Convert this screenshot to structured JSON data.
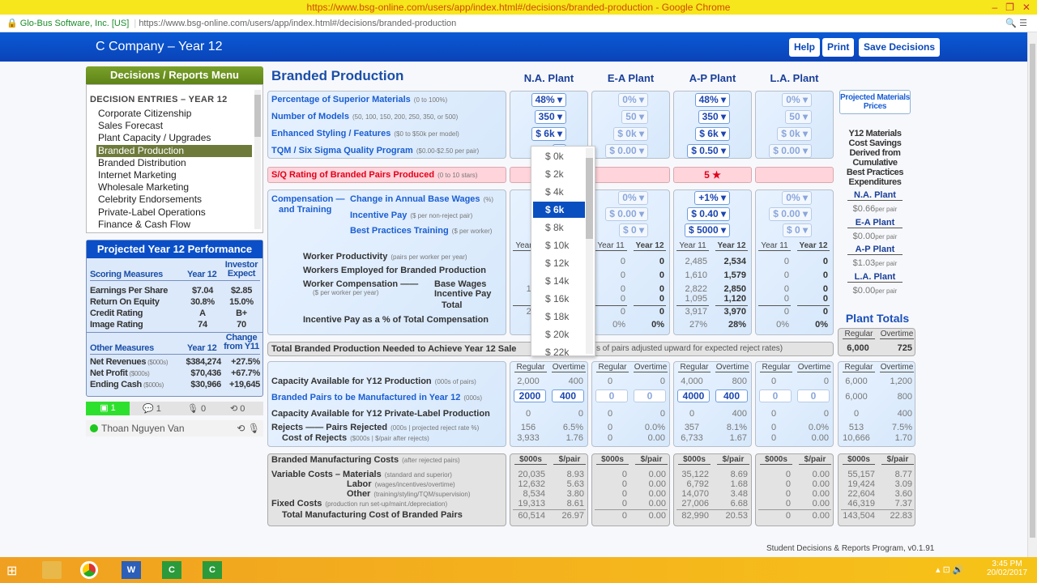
{
  "browser": {
    "title": "https://www.bsg-online.com/users/app/index.html#/decisions/branded-production - Google Chrome",
    "site_identity": "Glo-Bus Software, Inc. [US]",
    "url": "https://www.bsg-online.com/users/app/index.html#/decisions/branded-production"
  },
  "header": {
    "company": "C Company – Year 12",
    "help": "Help",
    "print": "Print",
    "save": "Save Decisions"
  },
  "menu": {
    "title": "Decisions / Reports Menu",
    "section": "DECISION  ENTRIES – YEAR 12",
    "items": [
      "Corporate Citizenship",
      "Sales Forecast",
      "Plant Capacity / Upgrades",
      "Branded Production",
      "Branded Distribution",
      "Internet Marketing",
      "Wholesale Marketing",
      "Celebrity Endorsements",
      "Private-Label Operations",
      "Finance & Cash Flow"
    ],
    "active_index": 3
  },
  "performance": {
    "title": "Projected Year 12 Performance",
    "scoring_head": [
      "Scoring Measures",
      "Year 12",
      "Investor Expect"
    ],
    "scoring": [
      [
        "Earnings Per Share",
        "$7.04",
        "$2.85"
      ],
      [
        "Return On Equity",
        "30.8%",
        "15.0%"
      ],
      [
        "Credit Rating",
        "A",
        "B+"
      ],
      [
        "Image Rating",
        "74",
        "70"
      ]
    ],
    "other_head": [
      "Other Measures",
      "Year 12",
      "Change from Y11"
    ],
    "other": [
      [
        "Net Revenues",
        "($000s)",
        "$384,274",
        "+27.5%"
      ],
      [
        "Net Profit",
        "($000s)",
        "$70,436",
        "+67.7%"
      ],
      [
        "Ending Cash",
        "($000s)",
        "$30,966",
        "+19,645"
      ]
    ]
  },
  "social": {
    "counts": [
      "1",
      "1",
      "0",
      "0"
    ],
    "user": "Thoan Nguyen Van"
  },
  "page": {
    "title": "Branded Production"
  },
  "labels": {
    "sup": "Percentage of Superior Materials",
    "sup_hint": "(0 to 100%)",
    "models": "Number of Models",
    "models_hint": "(50, 100, 150, 200, 250, 350, or 500)",
    "styling": "Enhanced Styling / Features",
    "styling_hint": "($0 to $50k per model)",
    "tqm": "TQM / Six Sigma Quality Program",
    "tqm_hint": "($0.00-$2.50 per pair)",
    "rating": "S/Q Rating of Branded Pairs Produced",
    "rating_hint": "(0 to 10 stars)",
    "comp1": "Compensation —",
    "comp2": "and Training",
    "wage": "Change in Annual Base Wages",
    "wage_hint": "(%)",
    "incentive": "Incentive Pay",
    "incentive_hint": "($ per non-reject pair)",
    "training": "Best Practices Training",
    "training_hint": "($ per worker)",
    "prod": "Worker Productivity",
    "prod_hint": "(pairs per worker per year)",
    "workers": "Workers Employed for Branded Production",
    "wcomp": "Worker Compensation ——",
    "wcomp_hint": "($ per worker per year)",
    "base": "Base Wages",
    "inc": "Incentive Pay",
    "total": "Total",
    "incpct": "Incentive Pay as a % of Total Compensation",
    "needed": "Total Branded Production Needed to Achieve Year 12 Sale",
    "needed_tail": "s of pairs adjusted upward for expected reject rates)",
    "cap": "Capacity Available for Y12 Production",
    "cap_hint": "(000s of pairs)",
    "mfg": "Branded Pairs to be Manufactured in Year 12",
    "mfg_hint": "(000s)",
    "pl": "Capacity Available for Y12 Private-Label Production",
    "rej": "Rejects —— Pairs Rejected",
    "rej_hint": "(000s | projected reject rate %)",
    "rejc": "Cost of Rejects",
    "rejc_hint": "($000s | $/pair after rejects)",
    "costs": "Branded Manufacturing Costs",
    "costs_hint": "(after rejected pairs)",
    "mat": "Variable Costs – Materials",
    "mat_hint": "(standard and superior)",
    "lab": "Labor",
    "lab_hint": "(wages/incentives/overtime)",
    "oth": "Other",
    "oth_hint": "(training/styling/TQM/supervision)",
    "fix": "Fixed Costs",
    "fix_hint": "(production run set-up/maint./depreciation)",
    "tot": "Total Manufacturing Cost of Branded Pairs",
    "year11": "Year 11",
    "year12": "Year 12",
    "regular": "Regular",
    "overtime": "Overtime",
    "k": "$000s",
    "pp": "$/pair"
  },
  "plants": [
    {
      "name": "N.A. Plant",
      "active": true,
      "sup": "48% ▾",
      "models": "350 ▾",
      "styling": "$ 6k ▾",
      "tqm": "$",
      "rating": "",
      "wage": "",
      "incentive": "$",
      "training": "$",
      "y11": [
        "3,9",
        "5",
        "15,1",
        "5,5",
        "20,7",
        "26"
      ],
      "y12": [
        "",
        "",
        "",
        "",
        "",
        ""
      ],
      "cap": [
        "2,000",
        "400"
      ],
      "mfg": [
        "2000",
        "400"
      ],
      "pl": [
        "0",
        "0"
      ],
      "rej": [
        "156",
        "6.5%"
      ],
      "rejc": [
        "3,933",
        "1.76"
      ],
      "cost": [
        [
          "20,035",
          "8.93"
        ],
        [
          "12,632",
          "5.63"
        ],
        [
          "8,534",
          "3.80"
        ],
        [
          "19,313",
          "8.61"
        ],
        [
          "60,514",
          "26.97"
        ]
      ]
    },
    {
      "name": "E-A Plant",
      "active": false,
      "sup": "0% ▾",
      "models": "50 ▾",
      "styling": "$ 0k ▾",
      "tqm": "$ 0.00 ▾",
      "rating": "",
      "wage": "0% ▾",
      "incentive": "$ 0.00 ▾",
      "training": "$ 0 ▾",
      "y11": [
        "0",
        "0",
        "0",
        "0",
        "0",
        "0%"
      ],
      "y12": [
        "0",
        "0",
        "0",
        "0",
        "0",
        "0%"
      ],
      "cap": [
        "0",
        "0"
      ],
      "mfg": [
        "0",
        "0"
      ],
      "pl": [
        "0",
        "0"
      ],
      "rej": [
        "0",
        "0.0%"
      ],
      "rejc": [
        "0",
        "0.00"
      ],
      "cost": [
        [
          "0",
          "0.00"
        ],
        [
          "0",
          "0.00"
        ],
        [
          "0",
          "0.00"
        ],
        [
          "0",
          "0.00"
        ],
        [
          "0",
          "0.00"
        ]
      ]
    },
    {
      "name": "A-P Plant",
      "active": true,
      "sup": "48% ▾",
      "models": "350 ▾",
      "styling": "$ 6k ▾",
      "tqm": "$ 0.50 ▾",
      "rating": "5 ★",
      "wage": "+1% ▾",
      "incentive": "$ 0.40 ▾",
      "training": "$ 5000 ▾",
      "y11": [
        "2,485",
        "1,610",
        "2,822",
        "1,095",
        "3,917",
        "27%"
      ],
      "y12": [
        "2,534",
        "1,579",
        "2,850",
        "1,120",
        "3,970",
        "28%"
      ],
      "cap": [
        "4,000",
        "800"
      ],
      "mfg": [
        "4000",
        "400"
      ],
      "pl": [
        "0",
        "400"
      ],
      "rej": [
        "357",
        "8.1%"
      ],
      "rejc": [
        "6,733",
        "1.67"
      ],
      "cost": [
        [
          "35,122",
          "8.69"
        ],
        [
          "6,792",
          "1.68"
        ],
        [
          "14,070",
          "3.48"
        ],
        [
          "27,006",
          "6.68"
        ],
        [
          "82,990",
          "20.53"
        ]
      ]
    },
    {
      "name": "L.A. Plant",
      "active": false,
      "sup": "0% ▾",
      "models": "50 ▾",
      "styling": "$ 0k ▾",
      "tqm": "$ 0.00 ▾",
      "rating": "",
      "wage": "0% ▾",
      "incentive": "$ 0.00 ▾",
      "training": "$ 0 ▾",
      "y11": [
        "0",
        "0",
        "0",
        "0",
        "0",
        "0%"
      ],
      "y12": [
        "0",
        "0",
        "0",
        "0",
        "0",
        "0%"
      ],
      "cap": [
        "0",
        "0"
      ],
      "mfg": [
        "0",
        "0"
      ],
      "pl": [
        "0",
        "0"
      ],
      "rej": [
        "0",
        "0.0%"
      ],
      "rejc": [
        "0",
        "0.00"
      ],
      "cost": [
        [
          "0",
          "0.00"
        ],
        [
          "0",
          "0.00"
        ],
        [
          "0",
          "0.00"
        ],
        [
          "0",
          "0.00"
        ],
        [
          "0",
          "0.00"
        ]
      ]
    }
  ],
  "totals": {
    "title": "Plant Totals",
    "needed": [
      "6,000",
      "725"
    ],
    "cap": [
      "6,000",
      "1,200"
    ],
    "mfg": [
      "6,000",
      "800"
    ],
    "pl": [
      "0",
      "400"
    ],
    "rej": [
      "513",
      "7.5%"
    ],
    "rejc": [
      "10,666",
      "1.70"
    ],
    "cost": [
      [
        "55,157",
        "8.77"
      ],
      [
        "19,424",
        "3.09"
      ],
      [
        "22,604",
        "3.60"
      ],
      [
        "46,319",
        "7.37"
      ],
      [
        "143,504",
        "22.83"
      ]
    ]
  },
  "side": {
    "prices_button": "Projected Materials Prices",
    "savings_title": "Y12 Materials Cost Savings Derived from Cumulative Best Practices Expenditures",
    "savings": [
      [
        "N.A. Plant",
        "$0.66"
      ],
      [
        "E-A Plant",
        "$0.00"
      ],
      [
        "A-P Plant",
        "$1.03"
      ],
      [
        "L.A. Plant",
        "$0.00"
      ]
    ],
    "per_pair": "per pair"
  },
  "dropdown": {
    "options": [
      "$ 0k",
      "$ 2k",
      "$ 4k",
      "$ 6k",
      "$ 8k",
      "$ 10k",
      "$ 12k",
      "$ 14k",
      "$ 16k",
      "$ 18k",
      "$ 20k",
      "$ 22k"
    ],
    "selected": "$ 6k"
  },
  "footer": {
    "version": "Student Decisions & Reports Program, v0.1.91"
  },
  "taskbar": {
    "time": "3:45 PM",
    "date": "20/02/2017"
  },
  "colors": {
    "header_blue": "#0a4fc8",
    "menu_green": "#6a8f1e",
    "active_item": "#6d7a3a",
    "rating_pink": "#ffd4db",
    "titlebar_yellow": "#f6e61c"
  }
}
